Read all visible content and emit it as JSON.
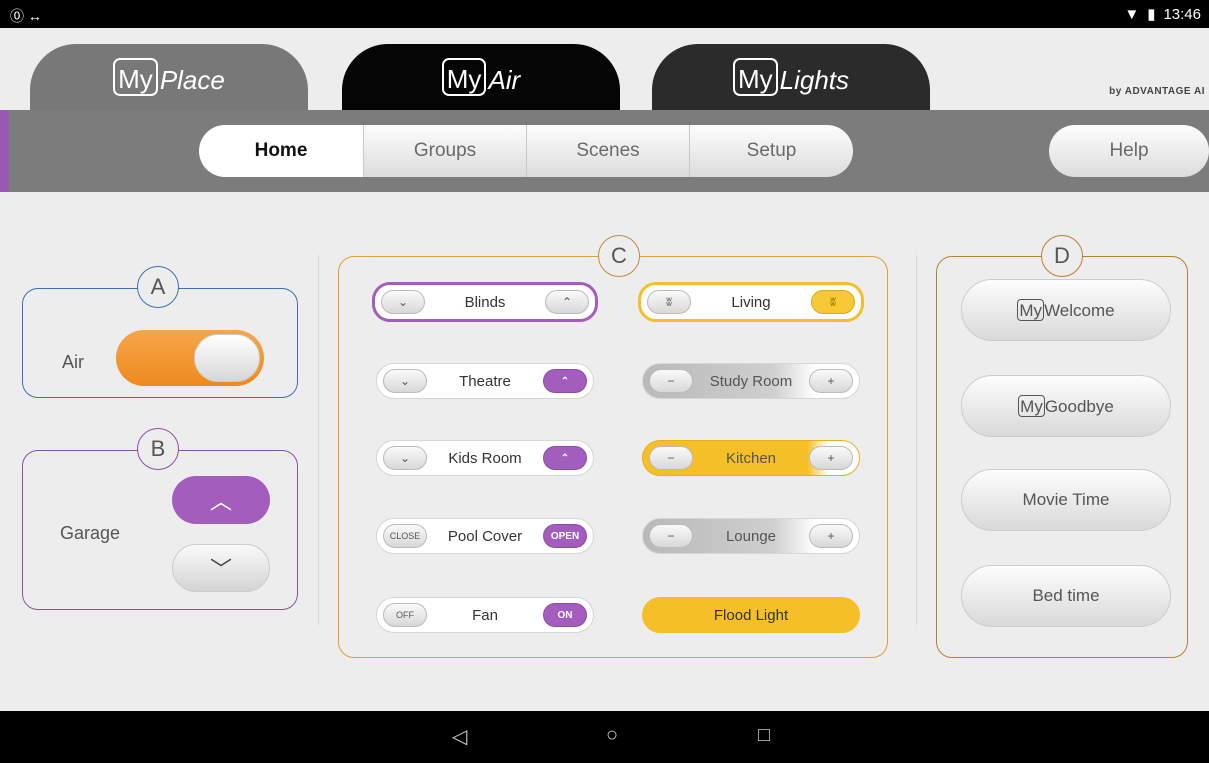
{
  "status": {
    "left_icons": "⓪ ↔",
    "time": "13:46"
  },
  "tabs": [
    {
      "box": "My",
      "rest": "Place"
    },
    {
      "box": "My",
      "rest": "Air"
    },
    {
      "box": "My",
      "rest": "Lights"
    }
  ],
  "brand": "by ADVANTAGE AI",
  "nav": {
    "items": [
      "Home",
      "Groups",
      "Scenes",
      "Setup"
    ],
    "help": "Help"
  },
  "markers": {
    "a": "A",
    "b": "B",
    "c": "C",
    "d": "D"
  },
  "air": {
    "label": "Air"
  },
  "garage": {
    "label": "Garage"
  },
  "controls": {
    "blinds": {
      "name": "Blinds"
    },
    "theatre": {
      "name": "Theatre"
    },
    "kids": {
      "name": "Kids Room"
    },
    "pool": {
      "name": "Pool Cover",
      "close": "CLOSE",
      "open": "OPEN"
    },
    "fan": {
      "name": "Fan",
      "off": "OFF",
      "on": "ON"
    },
    "living": {
      "name": "Living"
    },
    "study": {
      "name": "Study Room"
    },
    "kitchen": {
      "name": "Kitchen"
    },
    "lounge": {
      "name": "Lounge"
    },
    "flood": {
      "name": "Flood Light"
    }
  },
  "scenes": {
    "welcome": {
      "box": "My",
      "rest": "Welcome"
    },
    "goodbye": {
      "box": "My",
      "rest": "Goodbye"
    },
    "movie": "Movie Time",
    "bed": "Bed time"
  },
  "colors": {
    "accent_purple": "#a25dbd",
    "accent_orange": "#f29a32",
    "accent_gold": "#f5c027"
  }
}
